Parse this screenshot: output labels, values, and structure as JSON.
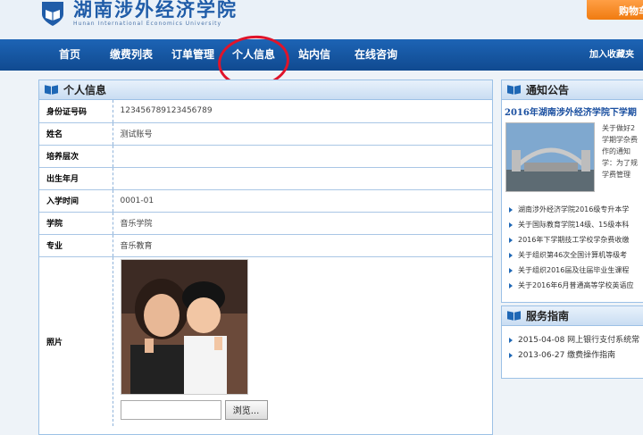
{
  "header": {
    "logo_cn": "湖南涉外经济学院",
    "logo_en": "Hunan International Economics University",
    "cart_label": "购物车"
  },
  "nav": {
    "items": [
      {
        "label": "首页"
      },
      {
        "label": "缴费列表"
      },
      {
        "label": "订单管理"
      },
      {
        "label": "个人信息"
      },
      {
        "label": "站内信"
      },
      {
        "label": "在线咨询"
      }
    ],
    "favorite_label": "加入收藏夹"
  },
  "profile": {
    "title": "个人信息",
    "rows": [
      {
        "label": "身份证号码",
        "value": "123456789123456789"
      },
      {
        "label": "姓名",
        "value": "测试账号"
      },
      {
        "label": "培养层次",
        "value": ""
      },
      {
        "label": "出生年月",
        "value": ""
      },
      {
        "label": "入学时间",
        "value": "0001-01"
      },
      {
        "label": "学院",
        "value": "音乐学院"
      },
      {
        "label": "专业",
        "value": "音乐教育"
      }
    ],
    "photo_label": "照片",
    "browse_label": "浏览..."
  },
  "notice": {
    "title": "通知公告",
    "headline": "2016年湖南涉外经济学院下学期",
    "summary_lines": [
      "关于做好2",
      "学期学杂费",
      "作的通知",
      "学：为了规",
      "学费管理"
    ],
    "items": [
      "湖南涉外经济学院2016级专升本学",
      "关于国际教育学院14级、15级本科",
      "2016年下学期技工学校学杂费收缴",
      "关于组织第46次全国计算机等级考",
      "关于组织2016届及往届毕业生课程",
      "关于2016年6月普通高等学校英语应"
    ]
  },
  "service": {
    "title": "服务指南",
    "items": [
      "2015-04-08 网上银行支付系统常",
      "2013-06-27 缴费操作指南"
    ]
  },
  "colors": {
    "nav_bg": "#1656a3",
    "cart": "#f28a1e",
    "highlight_circle": "#e0142a"
  }
}
